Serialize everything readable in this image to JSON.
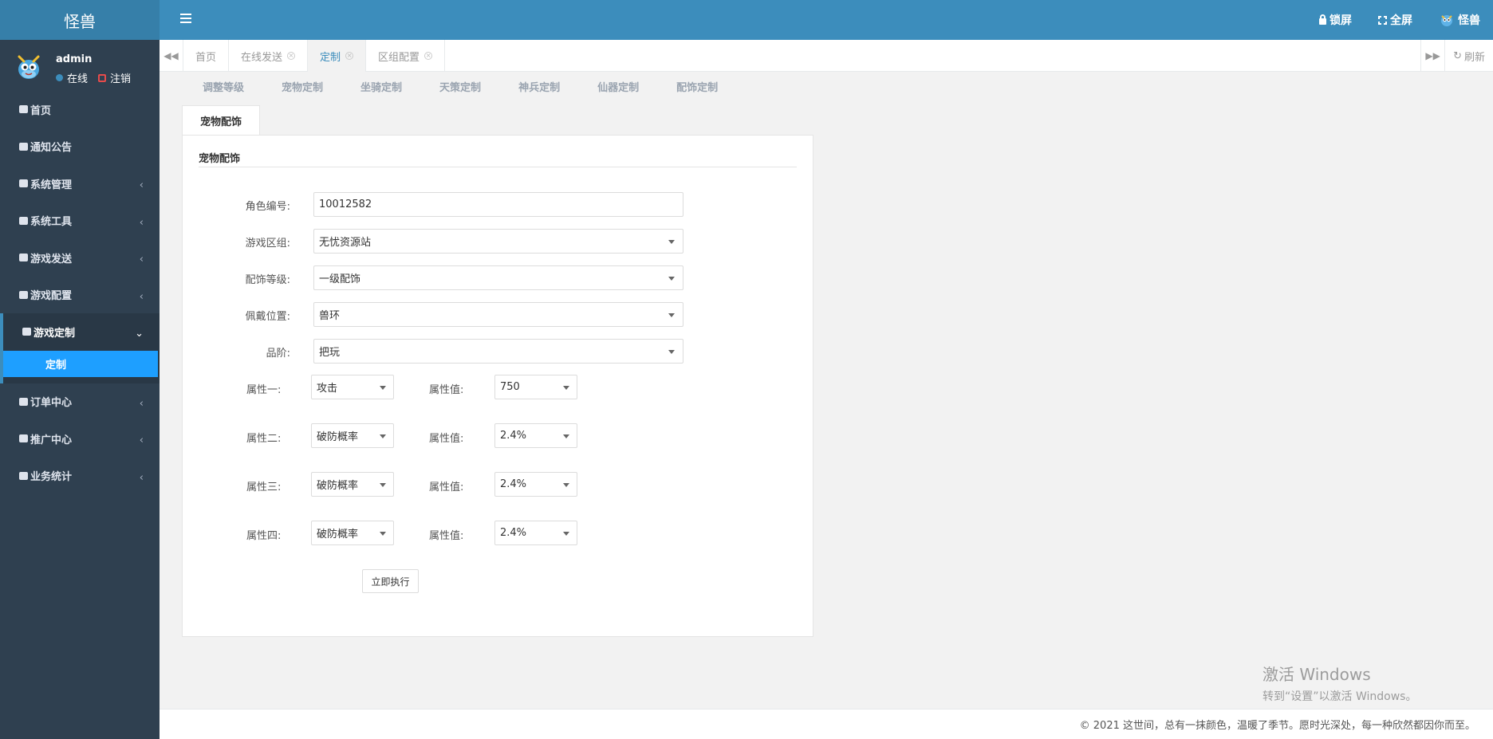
{
  "app": {
    "logo_text": "怪兽"
  },
  "topbar": {
    "lock_label": "锁屏",
    "fullscreen_label": "全屏",
    "user_label": "怪兽"
  },
  "user": {
    "name": "admin",
    "status": "在线",
    "logout": "注销"
  },
  "sidebar": {
    "items": [
      {
        "label": "首页"
      },
      {
        "label": "通知公告"
      },
      {
        "label": "系统管理"
      },
      {
        "label": "系统工具"
      },
      {
        "label": "游戏发送"
      },
      {
        "label": "游戏配置"
      },
      {
        "label": "游戏定制"
      },
      {
        "label": "订单中心"
      },
      {
        "label": "推广中心"
      },
      {
        "label": "业务统计"
      }
    ],
    "submenu_active": "定制"
  },
  "tabs": [
    {
      "label": "首页"
    },
    {
      "label": "在线发送"
    },
    {
      "label": "定制"
    },
    {
      "label": "区组配置"
    }
  ],
  "refresh_label": "刷新",
  "subnav": [
    "调整等级",
    "宠物定制",
    "坐骑定制",
    "天策定制",
    "神兵定制",
    "仙器定制",
    "配饰定制"
  ],
  "inner_tab": "宠物配饰",
  "form": {
    "title": "宠物配饰",
    "role_label": "角色编号:",
    "role_value": "10012582",
    "zone_label": "游戏区组:",
    "zone_value": "无忧资源站",
    "level_label": "配饰等级:",
    "level_value": "一级配饰",
    "position_label": "佩戴位置:",
    "position_value": "兽环",
    "grade_label": "品阶:",
    "grade_value": "把玩",
    "value_label": "属性值:",
    "attrs": [
      {
        "label": "属性一:",
        "attr": "攻击",
        "value": "750"
      },
      {
        "label": "属性二:",
        "attr": "破防概率",
        "value": "2.4%"
      },
      {
        "label": "属性三:",
        "attr": "破防概率",
        "value": "2.4%"
      },
      {
        "label": "属性四:",
        "attr": "破防概率",
        "value": "2.4%"
      }
    ],
    "submit_label": "立即执行"
  },
  "watermark": {
    "line1": "激活 Windows",
    "line2": "转到“设置”以激活 Windows。"
  },
  "footer": "© 2021 这世间，总有一抹颜色，温暖了季节。愿时光深处，每一种欣然都因你而至。"
}
